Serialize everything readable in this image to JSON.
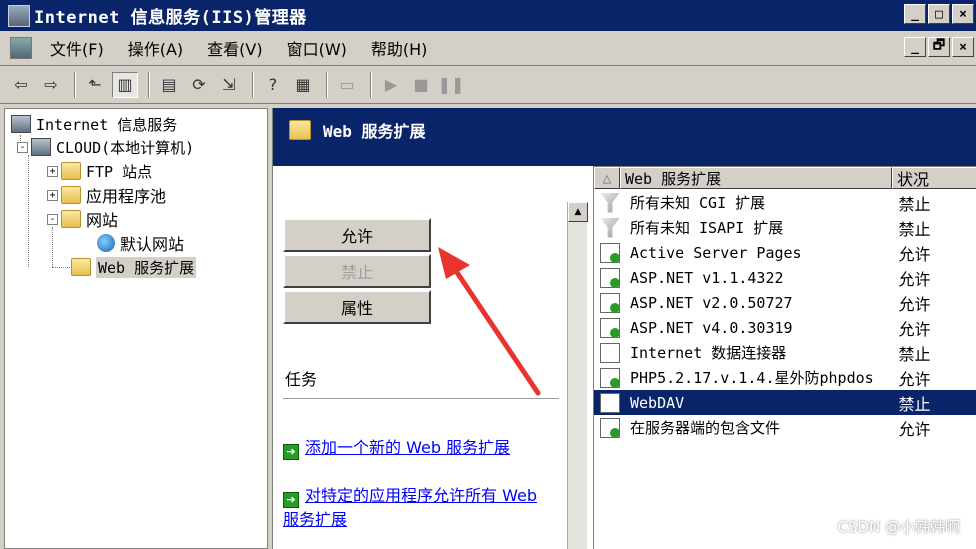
{
  "window": {
    "title": "Internet 信息服务(IIS)管理器",
    "controls": [
      "_",
      "□",
      "×"
    ],
    "mdi_controls": [
      "_",
      "🗗",
      "×"
    ]
  },
  "menu": [
    "文件(F)",
    "操作(A)",
    "查看(V)",
    "窗口(W)",
    "帮助(H)"
  ],
  "toolbar": {
    "buttons": [
      "back-icon",
      "forward-icon",
      "up-folder-icon",
      "show-hide-tree-icon",
      "properties-icon",
      "refresh-icon",
      "export-list-icon",
      "help-icon",
      "show-hide-action-pane-icon",
      "computer-icon",
      "play-icon",
      "stop-icon",
      "pause-icon"
    ]
  },
  "tree": {
    "root": "Internet 信息服务",
    "computer": "CLOUD(本地计算机)",
    "ftp": "FTP 站点",
    "app_pools": "应用程序池",
    "websites": "网站",
    "default_site": "默认网站",
    "web_ext": "Web 服务扩展",
    "expander_plus": "+",
    "expander_minus": "-"
  },
  "panel": {
    "title": "Web 服务扩展",
    "buttons": {
      "allow": "允许",
      "prohibit": "禁止",
      "properties": "属性"
    },
    "tasks_label": "任务",
    "task_links": [
      {
        "text": "添加一个新的 Web 服务扩展"
      },
      {
        "text": "对特定的应用程序允许所有 Web 服务扩展"
      }
    ]
  },
  "list": {
    "columns": {
      "sort": "△",
      "name": "Web 服务扩展",
      "status": "状况"
    },
    "rows": [
      {
        "name": "所有未知 CGI 扩展",
        "status": "禁止",
        "icon": "filter-icon"
      },
      {
        "name": "所有未知 ISAPI 扩展",
        "status": "禁止",
        "icon": "filter-icon"
      },
      {
        "name": "Active Server Pages",
        "status": "允许",
        "icon": "extension-allowed-icon"
      },
      {
        "name": "ASP.NET v1.1.4322",
        "status": "允许",
        "icon": "extension-allowed-icon"
      },
      {
        "name": "ASP.NET v2.0.50727",
        "status": "允许",
        "icon": "extension-allowed-icon"
      },
      {
        "name": "ASP.NET v4.0.30319",
        "status": "允许",
        "icon": "extension-allowed-icon"
      },
      {
        "name": "Internet 数据连接器",
        "status": "禁止",
        "icon": "extension-icon"
      },
      {
        "name": "PHP5.2.17.v.1.4.星外防phpdos",
        "status": "允许",
        "icon": "extension-allowed-icon"
      },
      {
        "name": "WebDAV",
        "status": "禁止",
        "icon": "extension-icon"
      },
      {
        "name": "在服务器端的包含文件",
        "status": "允许",
        "icon": "extension-allowed-icon"
      }
    ],
    "selected_index": 8
  },
  "watermark": "CSDN @小韩韩啊",
  "colors": {
    "titlebar": "#0a246a",
    "selection": "#0a246a",
    "annotation_arrow": "#e8332e"
  }
}
